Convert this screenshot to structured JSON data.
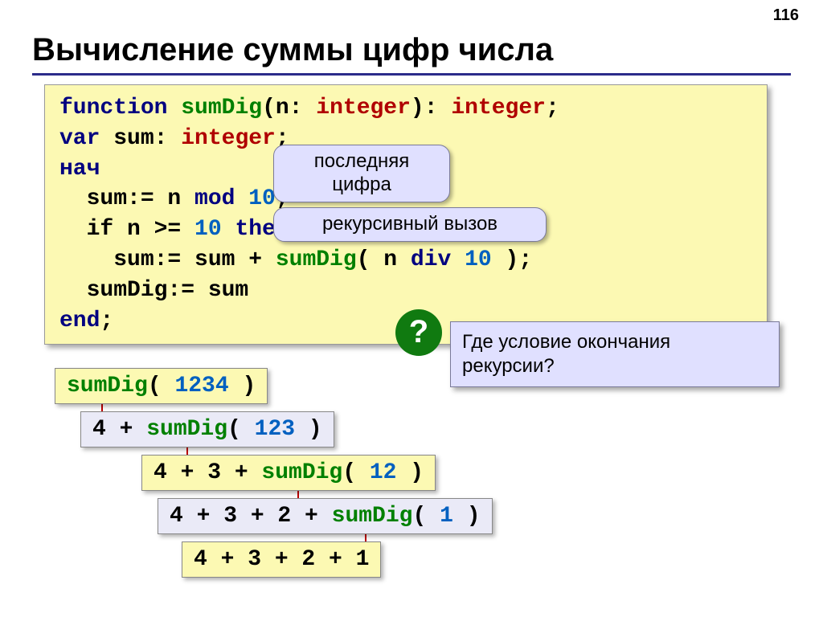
{
  "page_number": "116",
  "title": "Вычисление суммы цифр числа",
  "code": {
    "l1": {
      "t1": "function ",
      "t2": "sumDig",
      "t3": "(n: ",
      "t4": "integer",
      "t5": "): ",
      "t6": "integer",
      "t7": ";"
    },
    "l2": {
      "t1": "var ",
      "t2": "sum: ",
      "t3": "integer",
      "t4": ";"
    },
    "l3": {
      "t1": "нач"
    },
    "l4": {
      "t1": "  sum:= n ",
      "t2": "mod ",
      "t3": "10",
      "t4": ";"
    },
    "l5": {
      "t1": "  if n >= ",
      "t2": "10 ",
      "t3": "then"
    },
    "l6": {
      "t1": "    sum:= sum + ",
      "t2": "sumDig",
      "t3": "( n ",
      "t4": "div ",
      "t5": "10 ",
      "t6": ");"
    },
    "l7": {
      "t1": "  sumDig:= sum"
    },
    "l8": {
      "t1": "end",
      "t2": ";"
    }
  },
  "callouts": {
    "last_digit": "последняя цифра",
    "recursive": "рекурсивный вызов"
  },
  "question": {
    "mark": "?",
    "text": "Где условие окончания рекурсии?"
  },
  "steps": {
    "s1": {
      "a": "sumDig",
      "b": "( ",
      "c": "1234",
      "d": " )"
    },
    "s2": {
      "a": "4 + ",
      "b": "sumDig",
      "c": "( ",
      "d": "123",
      "e": " )"
    },
    "s3": {
      "a": "4 + 3 + ",
      "b": "sumDig",
      "c": "( ",
      "d": "12",
      "e": " )"
    },
    "s4": {
      "a": "4 + 3 + 2 + ",
      "b": "sumDig",
      "c": "( ",
      "d": "1",
      "e": " )"
    },
    "s5": {
      "a": "4 + 3 + 2 + 1"
    }
  }
}
